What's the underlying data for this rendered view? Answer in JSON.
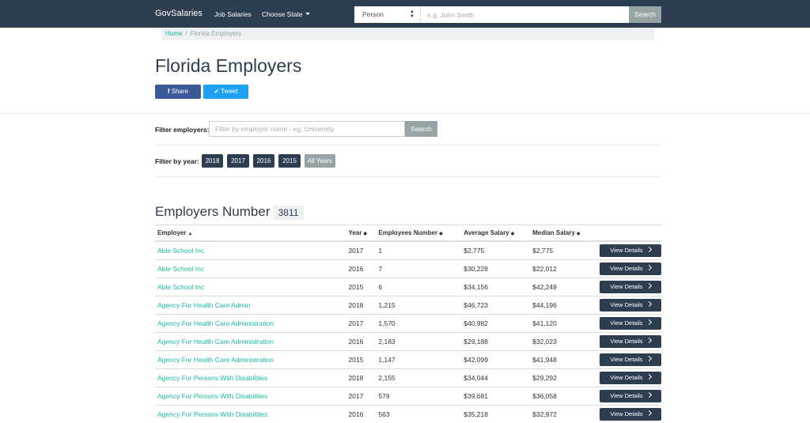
{
  "navbar": {
    "brand": "GovSalaries",
    "job_salaries": "Job Salaries",
    "choose_state": "Choose State",
    "search_type": "Person",
    "search_placeholder": "e.g. John Smith",
    "search_button": "Search"
  },
  "breadcrumb": {
    "home": "Home",
    "current": "Florida Employers"
  },
  "page": {
    "title": "Florida Employers",
    "share": "Share",
    "tweet": "Tweet"
  },
  "filter": {
    "label": "Filter employers:",
    "placeholder": "Filter by employer name - eg. University",
    "button": "Search",
    "year_label": "Filter by year:",
    "years": [
      "2018",
      "2017",
      "2016",
      "2015",
      "All Years"
    ]
  },
  "employers": {
    "title": "Employers Number",
    "count": "3811",
    "columns": [
      "Employer",
      "Year",
      "Employees Number",
      "Average Salary",
      "Median Salary"
    ],
    "details_label": "View Details",
    "rows": [
      [
        "Able School Inc",
        "2017",
        "1",
        "$2,775",
        "$2,775"
      ],
      [
        "Able School Inc",
        "2016",
        "7",
        "$30,228",
        "$22,012"
      ],
      [
        "Able School Inc",
        "2015",
        "6",
        "$34,156",
        "$42,249"
      ],
      [
        "Agency For Health Care Admin",
        "2018",
        "1,215",
        "$46,723",
        "$44,196"
      ],
      [
        "Agency For Health Care Administration",
        "2017",
        "1,570",
        "$40,982",
        "$41,120"
      ],
      [
        "Agency For Health Care Administration",
        "2016",
        "2,183",
        "$29,188",
        "$32,023"
      ],
      [
        "Agency For Health Care Administration",
        "2015",
        "1,147",
        "$42,099",
        "$41,948"
      ],
      [
        "Agency For Persons With Disabilities",
        "2018",
        "2,155",
        "$34,044",
        "$29,292"
      ],
      [
        "Agency For Persons With Disabilities",
        "2017",
        "579",
        "$39,681",
        "$36,058"
      ],
      [
        "Agency For Persons With Disabilities",
        "2016",
        "563",
        "$35,218",
        "$32,972"
      ]
    ]
  },
  "colors": {
    "navbar": "#2c3e50",
    "accent": "#18bc9c",
    "muted_button": "#95a5a6",
    "facebook": "#3b5998",
    "twitter": "#1da1f2"
  }
}
